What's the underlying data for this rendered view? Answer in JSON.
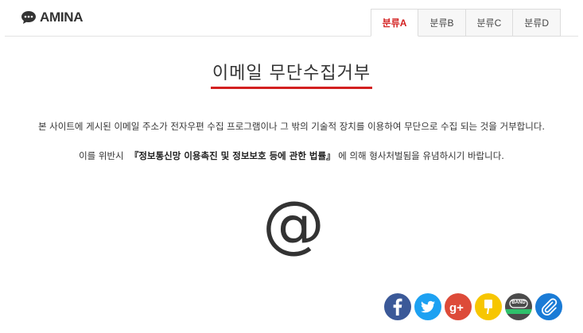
{
  "header": {
    "logo_text": "AMINA",
    "tabs": [
      {
        "label": "분류A",
        "active": true
      },
      {
        "label": "분류B",
        "active": false
      },
      {
        "label": "분류C",
        "active": false
      },
      {
        "label": "분류D",
        "active": false
      }
    ]
  },
  "main": {
    "title": "이메일 무단수집거부",
    "paragraph1": "본 사이트에 게시된 이메일 주소가 전자우편 수집 프로그램이나 그 밖의 기술적 장치를 이용하여 무단으로 수집 되는 것을 거부합니다.",
    "paragraph2_prefix": "이를 위반시",
    "paragraph2_law": "『정보통신망 이용촉진 및 정보보호 등에 관한 법률』",
    "paragraph2_suffix": "에 의해 형사처벌됨을 유념하시기 바랍니다.",
    "at_symbol": "@"
  },
  "share": {
    "band_label": "BAND",
    "icons": [
      "facebook-icon",
      "twitter-icon",
      "google-plus-icon",
      "kakaostory-icon",
      "band-icon",
      "link-icon"
    ]
  },
  "colors": {
    "accent": "#d32020",
    "facebook": "#3b5998",
    "twitter": "#1da1f2",
    "google_plus": "#dd4b39",
    "kakaostory": "#f7c600",
    "band": "#4b4b4b",
    "link": "#1a7bd6"
  }
}
